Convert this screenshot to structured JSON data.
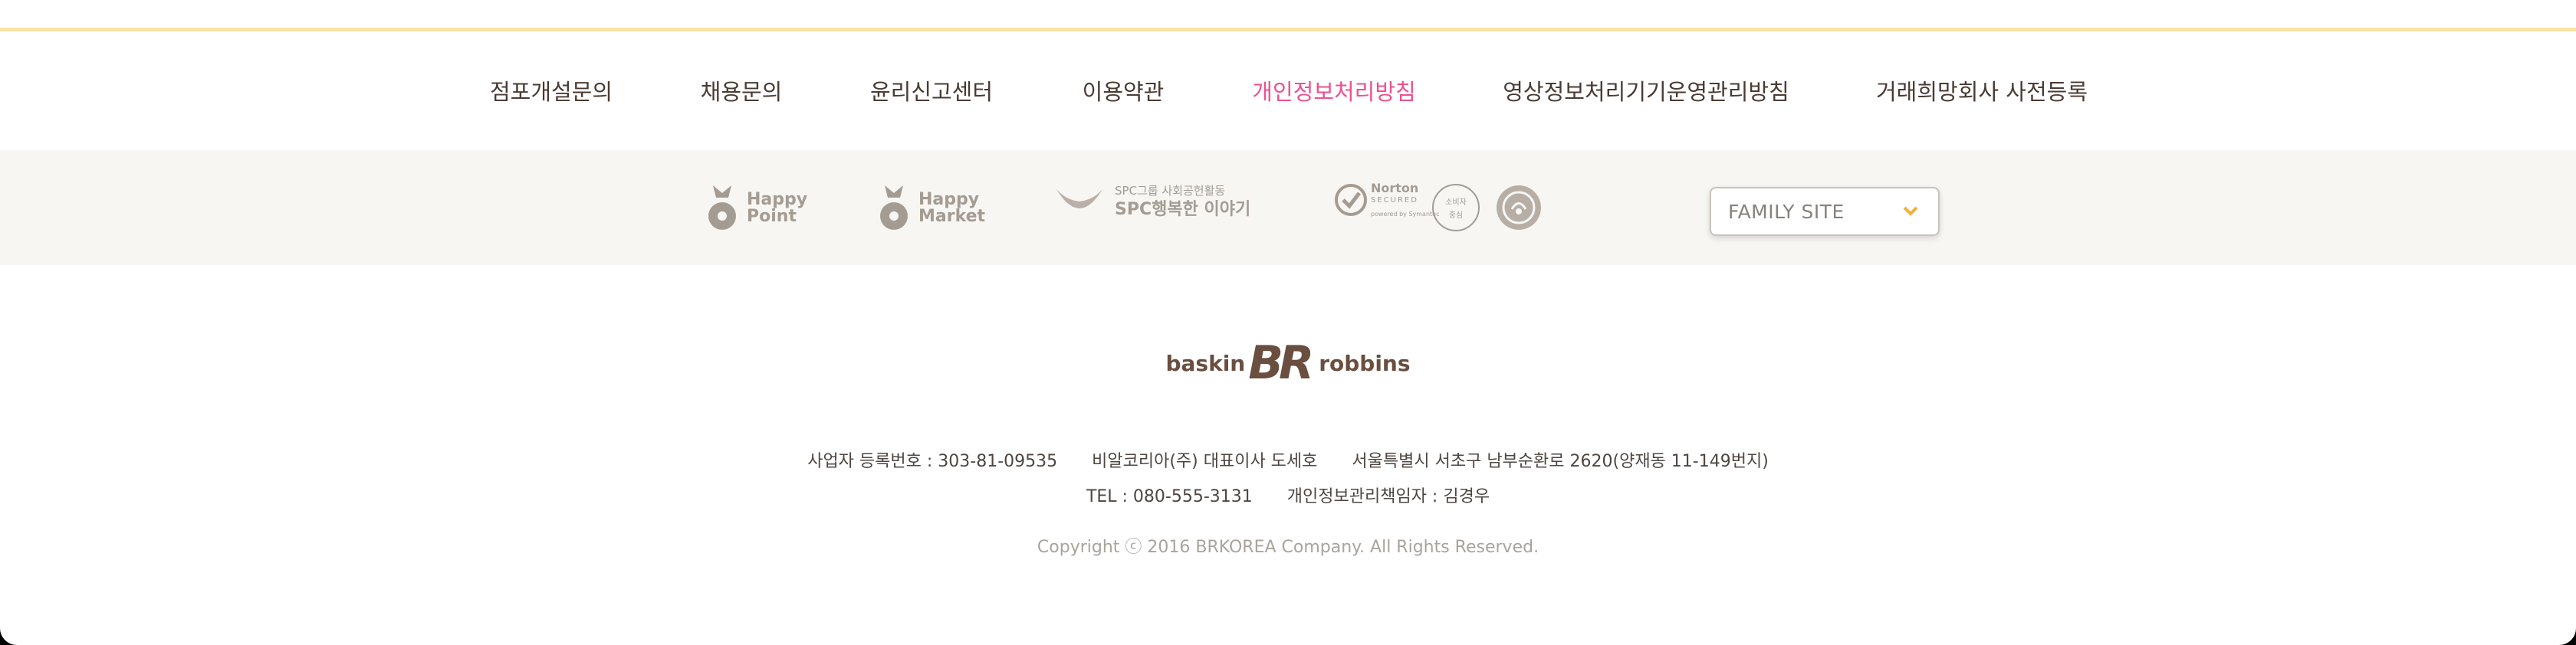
{
  "nav": {
    "items": [
      {
        "label": "점포개설문의"
      },
      {
        "label": "채용문의"
      },
      {
        "label": "윤리신고센터"
      },
      {
        "label": "이용약관"
      },
      {
        "label": "개인정보처리방침"
      },
      {
        "label": "영상정보처리기기운영관리방침"
      },
      {
        "label": "거래희망회사 사전등록"
      }
    ],
    "active_index": 4
  },
  "partners": {
    "happy_point": {
      "line1": "Happy",
      "line2": "Point"
    },
    "happy_market": {
      "line1": "Happy",
      "line2": "Market"
    },
    "spc": {
      "line1": "SPC그룹 사회공헌활동",
      "line2": "SPC행복한 이야기"
    },
    "norton": {
      "line1": "Norton",
      "line2": "SECURED",
      "line3": "powered by Symantec"
    },
    "cert_badge": {
      "line1": "소비자",
      "line2": "중심"
    }
  },
  "family_site": {
    "label": "FAMILY SITE",
    "icon": "chevron-down-icon"
  },
  "brand": {
    "left": "baskin",
    "mark": "BR",
    "right": "robbins"
  },
  "company_info": {
    "business_number": "사업자 등록번호 : 303-81-09535",
    "company": "비알코리아(주) 대표이사 도세호",
    "address": "서울특별시 서초구 남부순환로 2620(양재동 11-149번지)",
    "tel": "TEL : 080-555-3131",
    "privacy_officer": "개인정보관리책임자 : 김경우"
  },
  "copyright": "Copyright ⓒ 2016 BRKOREA Company. All Rights Reserved.",
  "colors": {
    "accent_pink": "#ed5190",
    "top_line": "#fbe3a4",
    "band_bg": "#f7f6f3",
    "chevron": "#f2b13b"
  }
}
